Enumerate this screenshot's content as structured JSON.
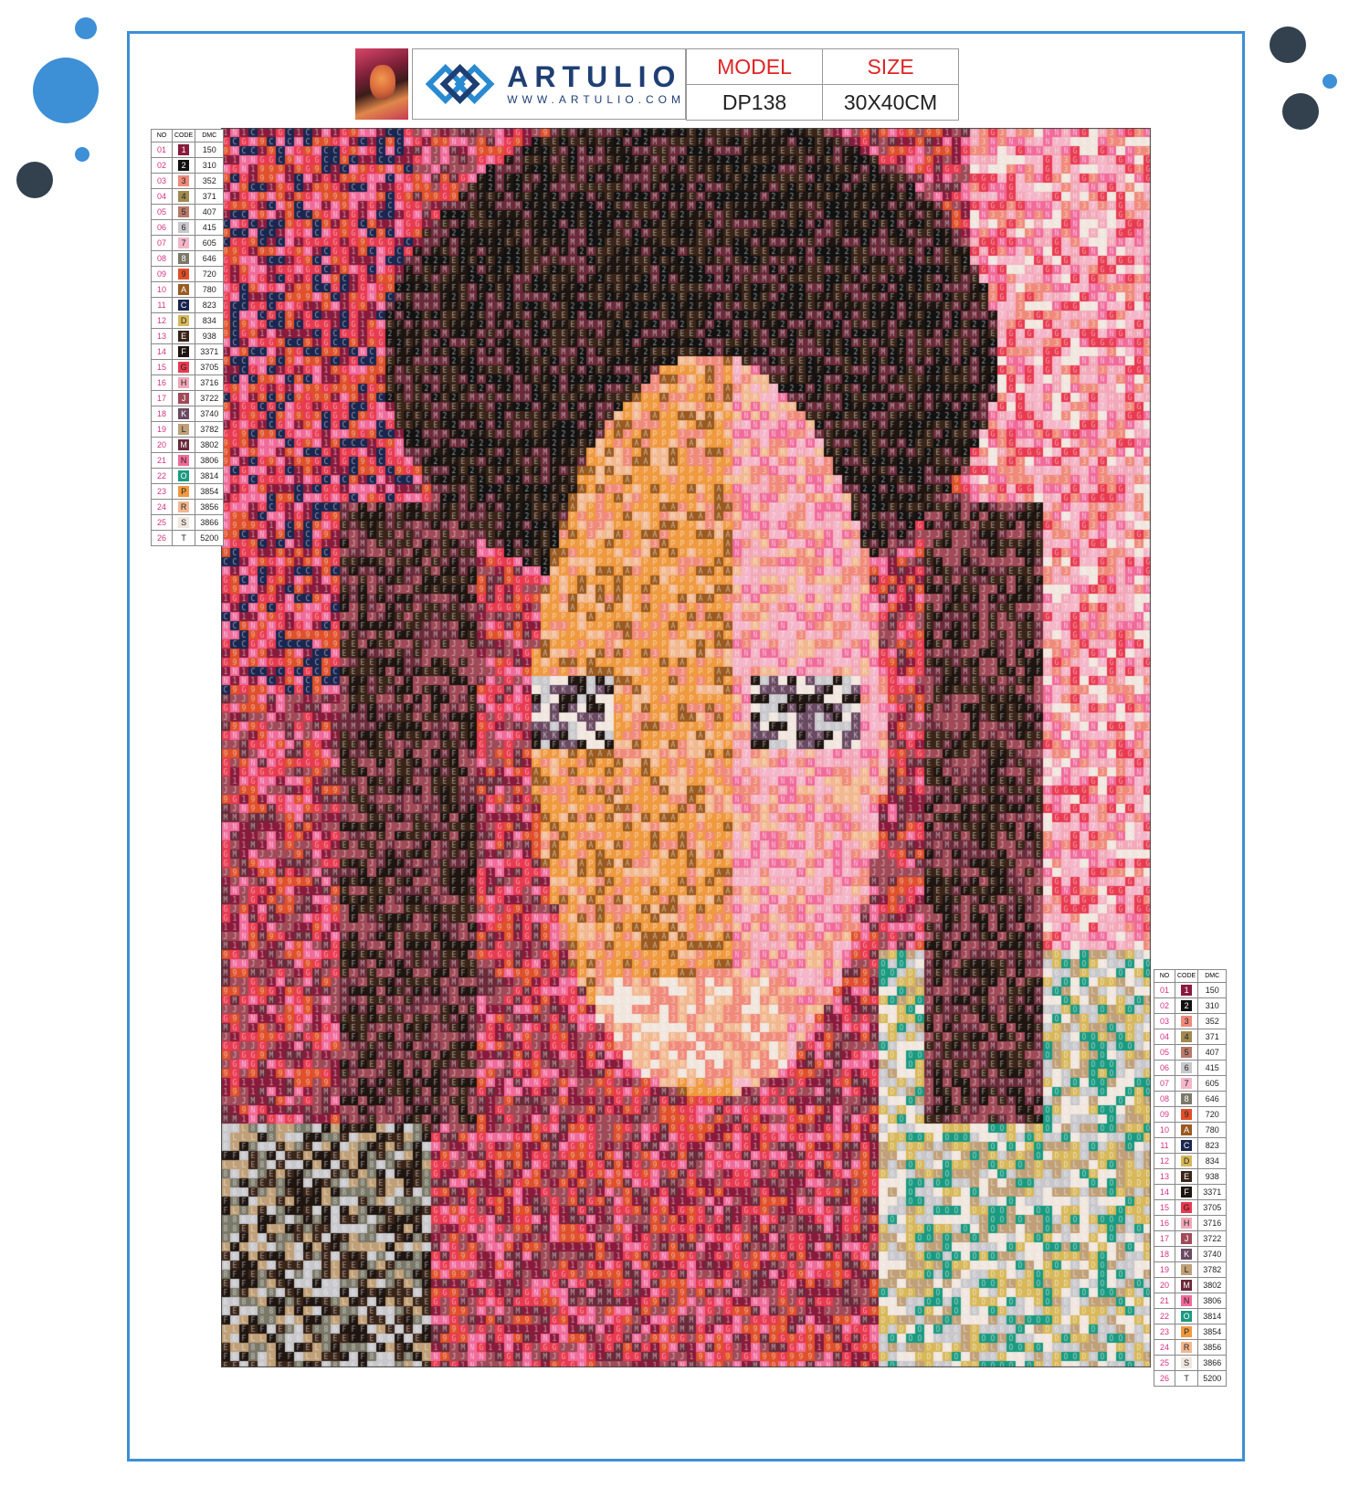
{
  "header": {
    "brand": "ARTULIO",
    "website": "WWW.ARTULIO.COM",
    "model_label": "MODEL",
    "size_label": "SIZE",
    "model_value": "DP138",
    "size_value": "30X40CM"
  },
  "legend": {
    "col_no": "NO",
    "col_code": "CODE",
    "col_dmc": "DMC",
    "rows": [
      {
        "no": "01",
        "code": "1",
        "dmc": "150",
        "color": "#8a1a3c"
      },
      {
        "no": "02",
        "code": "2",
        "dmc": "310",
        "color": "#111111"
      },
      {
        "no": "03",
        "code": "3",
        "dmc": "352",
        "color": "#f08a7a"
      },
      {
        "no": "04",
        "code": "4",
        "dmc": "371",
        "color": "#a08a50"
      },
      {
        "no": "05",
        "code": "5",
        "dmc": "407",
        "color": "#b8786a"
      },
      {
        "no": "06",
        "code": "6",
        "dmc": "415",
        "color": "#c8c8cc"
      },
      {
        "no": "07",
        "code": "7",
        "dmc": "605",
        "color": "#f4b6c8"
      },
      {
        "no": "08",
        "code": "8",
        "dmc": "646",
        "color": "#7a7868"
      },
      {
        "no": "09",
        "code": "9",
        "dmc": "720",
        "color": "#e0502a"
      },
      {
        "no": "10",
        "code": "A",
        "dmc": "780",
        "color": "#9a5a20"
      },
      {
        "no": "11",
        "code": "C",
        "dmc": "823",
        "color": "#1a2650"
      },
      {
        "no": "12",
        "code": "D",
        "dmc": "834",
        "color": "#d8b85a"
      },
      {
        "no": "13",
        "code": "E",
        "dmc": "938",
        "color": "#3a2418"
      },
      {
        "no": "14",
        "code": "F",
        "dmc": "3371",
        "color": "#1e1410"
      },
      {
        "no": "15",
        "code": "G",
        "dmc": "3705",
        "color": "#e83a50"
      },
      {
        "no": "16",
        "code": "H",
        "dmc": "3716",
        "color": "#f2a8b8"
      },
      {
        "no": "17",
        "code": "J",
        "dmc": "3722",
        "color": "#a04a58"
      },
      {
        "no": "18",
        "code": "K",
        "dmc": "3740",
        "color": "#6a4a62"
      },
      {
        "no": "19",
        "code": "L",
        "dmc": "3782",
        "color": "#c0a078"
      },
      {
        "no": "20",
        "code": "M",
        "dmc": "3802",
        "color": "#6a2a3a"
      },
      {
        "no": "21",
        "code": "N",
        "dmc": "3806",
        "color": "#f06a9a"
      },
      {
        "no": "22",
        "code": "O",
        "dmc": "3814",
        "color": "#1a9a80"
      },
      {
        "no": "23",
        "code": "P",
        "dmc": "3854",
        "color": "#f09a40"
      },
      {
        "no": "24",
        "code": "R",
        "dmc": "3856",
        "color": "#f2b890"
      },
      {
        "no": "25",
        "code": "S",
        "dmc": "3866",
        "color": "#f0e6de"
      },
      {
        "no": "26",
        "code": "T",
        "dmc": "5200",
        "color": "#ffffff"
      }
    ]
  },
  "colors": {
    "frame": "#3d8fd6",
    "dot_blue": "#3d8fd6",
    "dot_dark": "#33414e",
    "brand": "#1f3f74",
    "label_red": "#e02424",
    "number_pink": "#d63384"
  },
  "mosaic": {
    "cell_size": 10,
    "description_icon": "diamond-painting-grid"
  }
}
